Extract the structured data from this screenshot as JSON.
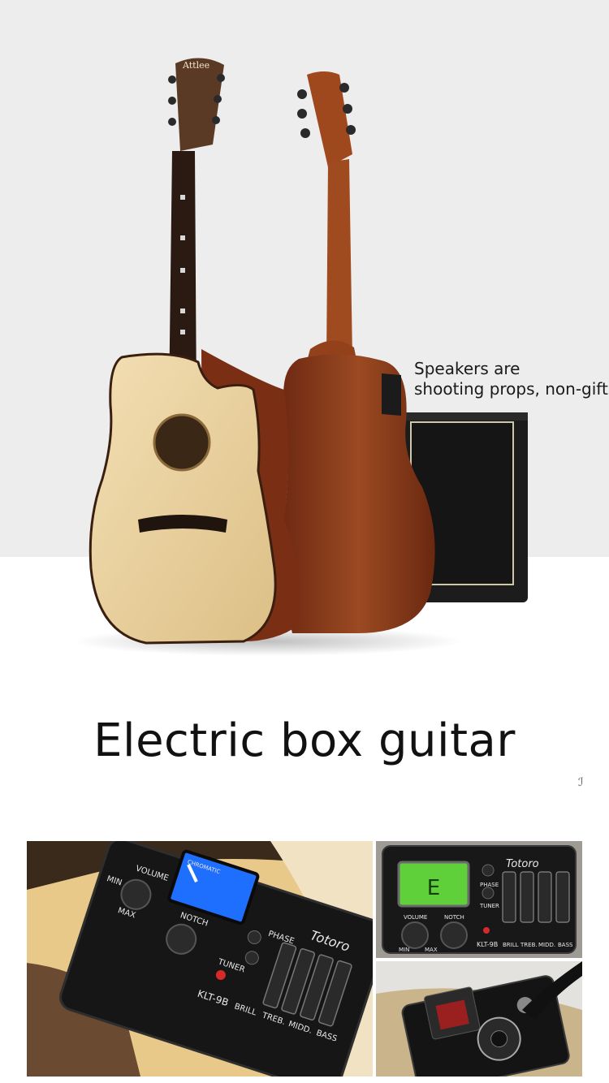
{
  "hero": {
    "caption_line1": "Speakers are",
    "caption_line2": "shooting props, non-gifts",
    "headstock_brand": "Attlee"
  },
  "section": {
    "title": "Electric box guitar",
    "stray_mark": "ℐ"
  },
  "preamp_main": {
    "display_label": "CHROMATIC",
    "knob_volume": "VOLUME",
    "knob_min": "MIN",
    "knob_max": "MAX",
    "knob_notch": "NOTCH",
    "phase": "PHASE",
    "tuner": "TUNER",
    "brand": "Totoro",
    "model": "KLT-9B",
    "sliders": [
      "BRILL",
      "TREB.",
      "MIDD.",
      "BASS"
    ]
  },
  "preamp_small": {
    "display_note": "E",
    "brand": "Totoro",
    "phase": "PHASE",
    "tuner": "TUNER",
    "knob_volume": "VOLUME",
    "knob_notch": "NOTCH",
    "knob_min": "MIN",
    "knob_max": "MAX",
    "model": "KLT-9B",
    "sliders": [
      "BRILL",
      "TREB.",
      "MIDD.",
      "BASS"
    ]
  },
  "colors": {
    "backdrop": "#ededed",
    "spruce_top": "#e8cf9e",
    "mahogany": "#8a3a1c",
    "amp": "#1b1b1b",
    "lcd_blue": "#1f6fff",
    "lcd_green": "#5fcf3a"
  }
}
